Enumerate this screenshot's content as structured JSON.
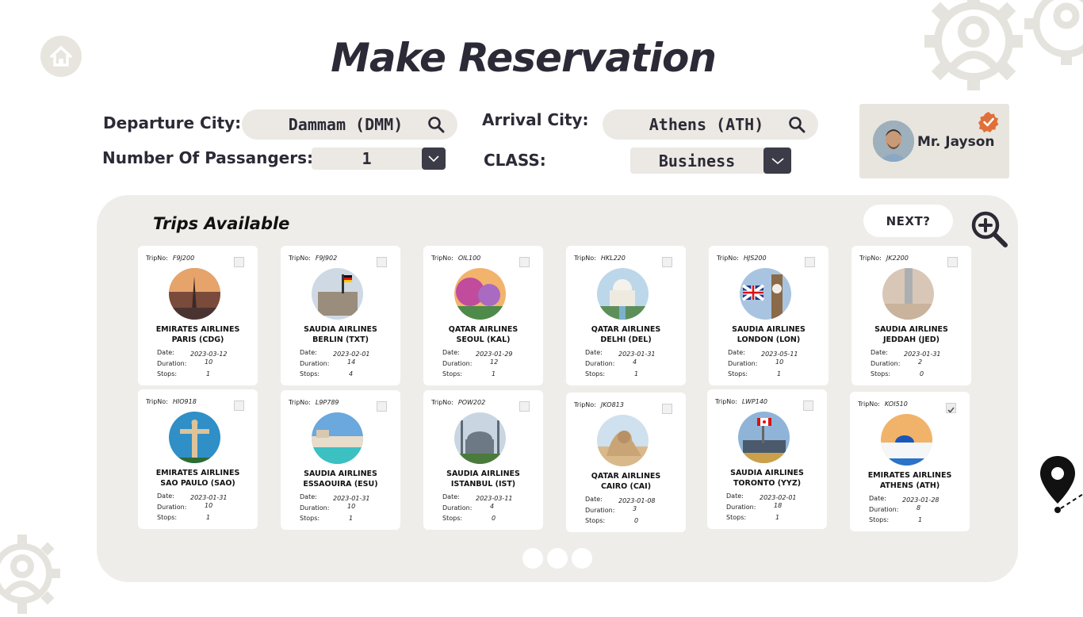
{
  "header": {
    "title": "Make Reservation"
  },
  "form": {
    "departure_label": "Departure City:",
    "departure_value": "Dammam (DMM)",
    "arrival_label": "Arrival City:",
    "arrival_value": "Athens (ATH)",
    "passengers_label": "Number Of Passangers:",
    "passengers_value": "1",
    "class_label": "CLASS:",
    "class_value": "Business"
  },
  "profile": {
    "name": "Mr. Jayson",
    "badge_color": "#e0703a"
  },
  "trips": {
    "title": "Trips Available",
    "next_label": "NEXT?",
    "field_labels": {
      "tripno": "TripNo:",
      "date": "Date:",
      "duration": "Duration:",
      "stops": "Stops:"
    },
    "cards": [
      {
        "tripno": "F9J200",
        "airline": "EMIRATES AIRLINES",
        "dest": "PARIS (CDG)",
        "date": "2023-03-12",
        "duration": "10",
        "stops": "1",
        "checked": false
      },
      {
        "tripno": "F9J902",
        "airline": "SAUDIA AIRLINES",
        "dest": "BERLIN (TXT)",
        "date": "2023-02-01",
        "duration": "14",
        "stops": "4",
        "checked": false
      },
      {
        "tripno": "OIL100",
        "airline": "QATAR AIRLINES",
        "dest": "SEOUL (KAL)",
        "date": "2023-01-29",
        "duration": "12",
        "stops": "1",
        "checked": false
      },
      {
        "tripno": "HKL220",
        "airline": "QATAR AIRLINES",
        "dest": "DELHI (DEL)",
        "date": "2023-01-31",
        "duration": "4",
        "stops": "1",
        "checked": false
      },
      {
        "tripno": "HJS200",
        "airline": "SAUDIA AIRLINES",
        "dest": "LONDON (LON)",
        "date": "2023-05-11",
        "duration": "10",
        "stops": "1",
        "checked": false
      },
      {
        "tripno": "JK2200",
        "airline": "SAUDIA AIRLINES",
        "dest": "JEDDAH (JED)",
        "date": "2023-01-31",
        "duration": "2",
        "stops": "0",
        "checked": false
      },
      {
        "tripno": "HIO918",
        "airline": "EMIRATES AIRLINES",
        "dest": "SAO PAULO (SAO)",
        "date": "2023-01-31",
        "duration": "10",
        "stops": "1",
        "checked": false
      },
      {
        "tripno": "L9P789",
        "airline": "SAUDIA AIRLINES",
        "dest": "ESSAOUIRA (ESU)",
        "date": "2023-01-31",
        "duration": "10",
        "stops": "1",
        "checked": false
      },
      {
        "tripno": "POW202",
        "airline": "SAUDIA AIRLINES",
        "dest": "ISTANBUL (IST)",
        "date": "2023-03-11",
        "duration": "4",
        "stops": "0",
        "checked": false
      },
      {
        "tripno": "JKO813",
        "airline": "QATAR AIRLINES",
        "dest": "CAIRO (CAI)",
        "date": "2023-01-08",
        "duration": "3",
        "stops": "0",
        "checked": false
      },
      {
        "tripno": "LWP140",
        "airline": "SAUDIA AIRLINES",
        "dest": "TORONTO (YYZ)",
        "date": "2023-02-01",
        "duration": "18",
        "stops": "1",
        "checked": false
      },
      {
        "tripno": "KOI510",
        "airline": "EMIRATES AIRLINES",
        "dest": "ATHENS (ATH)",
        "date": "2023-01-28",
        "duration": "8",
        "stops": "1",
        "checked": true
      }
    ]
  },
  "colors": {
    "dark": "#2b2a36",
    "panel": "#efede9",
    "pill": "#ece9e4",
    "deco": "#e3e0da"
  },
  "icons": [
    "home-icon",
    "search-icon",
    "chevron-down-icon",
    "verified-icon",
    "zoom-in-icon",
    "location-pin-icon",
    "gear-user-icon"
  ]
}
